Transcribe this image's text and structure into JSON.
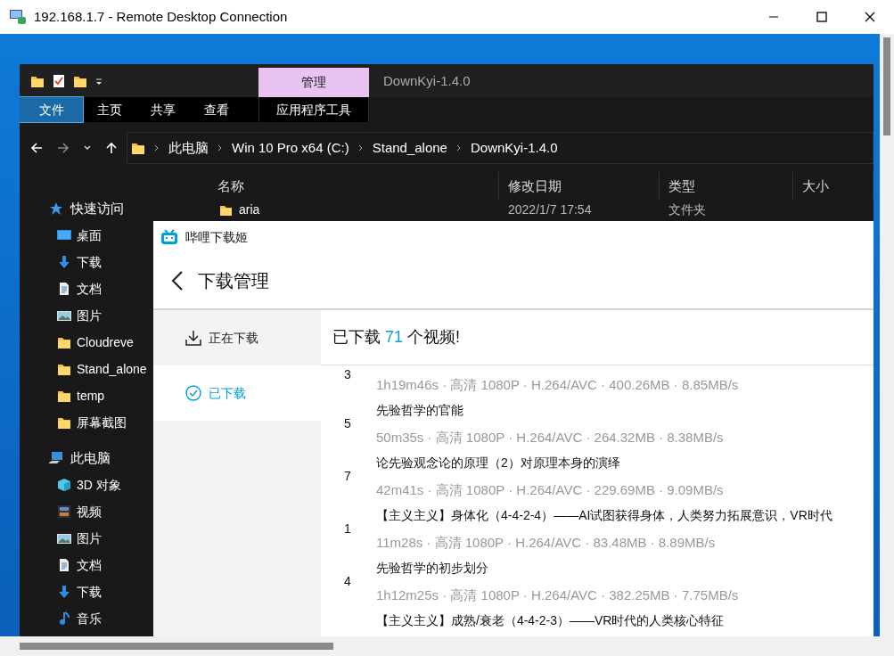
{
  "rdp": {
    "title": "192.168.1.7 - Remote Desktop Connection"
  },
  "explorer": {
    "title": "DownKyi-1.4.0",
    "context_tab": "管理",
    "ribbon_tabs": [
      {
        "label": "文件",
        "kind": "file",
        "selected": true
      },
      {
        "label": "主页",
        "kind": "tab",
        "selected": false
      },
      {
        "label": "共享",
        "kind": "tab",
        "selected": false
      },
      {
        "label": "查看",
        "kind": "tab",
        "selected": false
      },
      {
        "label": "应用程序工具",
        "kind": "context",
        "selected": false
      }
    ],
    "breadcrumb": [
      "此电脑",
      "Win 10 Pro x64 (C:)",
      "Stand_alone",
      "DownKyi-1.4.0"
    ],
    "columns": [
      "名称",
      "修改日期",
      "类型",
      "大小"
    ],
    "rows": [
      {
        "name": "aria",
        "modified": "2022/1/7 17:54",
        "type": "文件夹"
      }
    ],
    "nav": [
      {
        "label": "快速访问",
        "kind": "star",
        "children": [
          {
            "label": "桌面",
            "kind": "desktop"
          },
          {
            "label": "下载",
            "kind": "download"
          },
          {
            "label": "文档",
            "kind": "document"
          },
          {
            "label": "图片",
            "kind": "image"
          },
          {
            "label": "Cloudreve",
            "kind": "folder"
          },
          {
            "label": "Stand_alone",
            "kind": "folder"
          },
          {
            "label": "temp",
            "kind": "folder"
          },
          {
            "label": "屏幕截图",
            "kind": "folder"
          }
        ]
      },
      {
        "label": "此电脑",
        "kind": "pc",
        "children": [
          {
            "label": "3D 对象",
            "kind": "cube"
          },
          {
            "label": "视频",
            "kind": "video"
          },
          {
            "label": "图片",
            "kind": "image"
          },
          {
            "label": "文档",
            "kind": "document"
          },
          {
            "label": "下载",
            "kind": "download"
          },
          {
            "label": "音乐",
            "kind": "music"
          }
        ]
      }
    ]
  },
  "downkyi": {
    "app_title": "哔哩下载姬",
    "page_title": "下载管理",
    "menu": [
      {
        "label": "正在下载",
        "kind": "downloading",
        "selected": false
      },
      {
        "label": "已下载",
        "kind": "done",
        "selected": true
      }
    ],
    "summary": {
      "before": "已下载",
      "count": "71",
      "after": "个视频!"
    },
    "videos": [
      {
        "number": "3",
        "meta": "1h19m46s · 高清 1080P · H.264/AVC · 400.26MB · 8.85MB/s"
      },
      {
        "number": "5",
        "title": "先验哲学的官能",
        "meta": "50m35s · 高清 1080P · H.264/AVC · 264.32MB · 8.38MB/s"
      },
      {
        "number": "7",
        "title": "论先验观念论的原理（2）对原理本身的演绎",
        "meta": "42m41s · 高清 1080P · H.264/AVC · 229.69MB · 9.09MB/s"
      },
      {
        "number": "1",
        "title": "【主义主义】身体化（4-4-2-4）——AI试图获得身体，人类努力拓展意识，VR时代",
        "meta": "11m28s · 高清 1080P · H.264/AVC · 83.48MB · 8.89MB/s"
      },
      {
        "number": "4",
        "title": "先验哲学的初步划分",
        "meta": "1h12m25s · 高清 1080P · H.264/AVC · 382.25MB · 7.75MB/s"
      },
      {
        "title": "【主义主义】成熟/衰老（4-4-2-3）——VR时代的人类核心特征"
      }
    ]
  }
}
